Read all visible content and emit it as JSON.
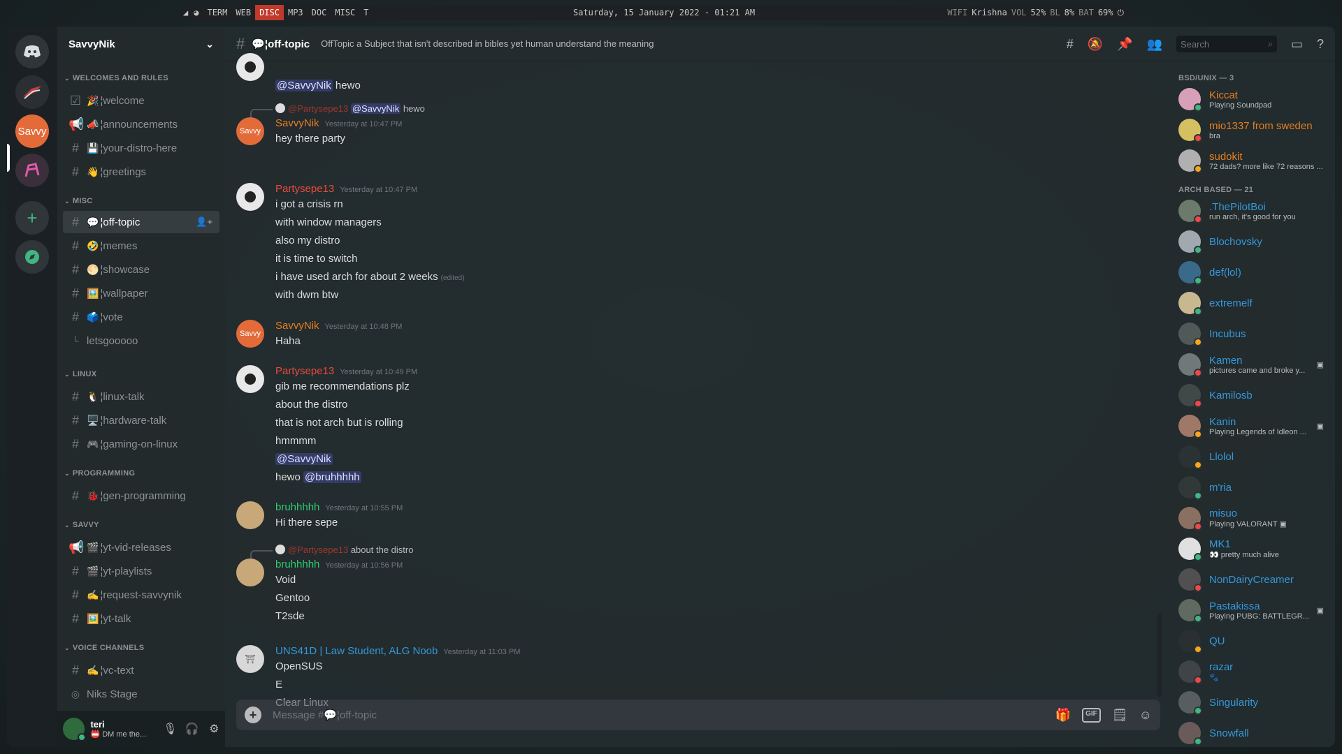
{
  "topbar": {
    "workspaces": [
      {
        "label": "TERM",
        "active": false
      },
      {
        "label": "WEB",
        "active": false
      },
      {
        "label": "DISC",
        "active": true
      },
      {
        "label": "MP3",
        "active": false
      },
      {
        "label": "DOC",
        "active": false
      },
      {
        "label": "MISC",
        "active": false
      },
      {
        "label": "T",
        "active": false
      }
    ],
    "datetime": "Saturday, 15 January 2022 - 01:21 AM",
    "wifi_label": "WIFI",
    "wifi_value": "Krishna",
    "vol_label": "VOL",
    "vol_value": "52%",
    "bl_label": "BL",
    "bl_value": "8%",
    "bat_label": "BAT",
    "bat_value": "69%"
  },
  "rail": {
    "servers": [
      {
        "name": "discord-home-icon"
      },
      {
        "name": "rog-server-icon"
      },
      {
        "name": "savvy-server",
        "label": "Savvy"
      },
      {
        "name": "pink-server-icon"
      },
      {
        "name": "add-server-icon"
      },
      {
        "name": "explore-icon"
      }
    ]
  },
  "sidebar": {
    "server_name": "SavvyNik",
    "categories": [
      {
        "label": "WELCOMES AND RULES",
        "channels": [
          {
            "emoji": "🎉",
            "name": "welcome"
          },
          {
            "emoji": "📣",
            "name": "announcements"
          },
          {
            "emoji": "💾",
            "name": "your-distro-here"
          },
          {
            "emoji": "👋",
            "name": "greetings"
          }
        ]
      },
      {
        "label": "MISC",
        "channels": [
          {
            "emoji": "💬",
            "name": "off-topic"
          },
          {
            "emoji": "🤣",
            "name": "memes"
          },
          {
            "emoji": "🌕",
            "name": "showcase"
          },
          {
            "emoji": "🖼️",
            "name": "wallpaper"
          },
          {
            "emoji": "🗳️",
            "name": "vote"
          },
          {
            "emoji": "",
            "name": "letsgooooo"
          }
        ]
      },
      {
        "label": "LINUX",
        "channels": [
          {
            "emoji": "🐧",
            "name": "linux-talk"
          },
          {
            "emoji": "🖥️",
            "name": "hardware-talk"
          },
          {
            "emoji": "🎮",
            "name": "gaming-on-linux"
          }
        ]
      },
      {
        "label": "PROGRAMMING",
        "channels": [
          {
            "emoji": "🐞",
            "name": "gen-programming"
          }
        ]
      },
      {
        "label": "SAVVY",
        "channels": [
          {
            "emoji": "🎬",
            "name": "yt-vid-releases"
          },
          {
            "emoji": "🎬",
            "name": "yt-playlists"
          },
          {
            "emoji": "✍️",
            "name": "request-savvynik"
          },
          {
            "emoji": "🖼️",
            "name": "yt-talk"
          }
        ]
      },
      {
        "label": "VOICE CHANNELS",
        "channels": [
          {
            "emoji": "✍️",
            "name": "vc-text"
          },
          {
            "emoji": "",
            "name": "Niks Stage"
          }
        ]
      }
    ],
    "user": {
      "name": "teri",
      "status": "📛 DM me the..."
    }
  },
  "chat": {
    "channel_title": "💬¦off-topic",
    "topic": "OffTopic a Subject that isn't described in bibles yet human understand the meaning",
    "search_placeholder": "Search",
    "composer_placeholder": "Message #💬¦off-topic",
    "gif_label": "GIF",
    "colors": {
      "savvy": "#e67e22",
      "party": "#e74c3c",
      "bruh": "#2ecc71",
      "uns": "#3498db"
    },
    "messages": {
      "m0": {
        "mention": "@SavvyNik",
        "text": "hewo"
      },
      "m1": {
        "reply_name": "@Partysepe13",
        "reply_mention": "@SavvyNik",
        "reply_text": "hewo",
        "author": "SavvyNik",
        "time": "Yesterday at 10:47 PM",
        "avatar": "Savvy",
        "lines": [
          "hey there party"
        ]
      },
      "m2": {
        "author": "Partysepe13",
        "time": "Yesterday at 10:47 PM",
        "lines": [
          "i got a crisis rn",
          "with window managers",
          "also my distro",
          "it is time to switch",
          "i have used arch for about 2 weeks",
          "with dwm btw"
        ],
        "edited": "(edited)"
      },
      "m3": {
        "author": "SavvyNik",
        "time": "Yesterday at 10:48 PM",
        "avatar": "Savvy",
        "lines": [
          "Haha"
        ]
      },
      "m4": {
        "author": "Partysepe13",
        "time": "Yesterday at 10:49 PM",
        "lines": [
          "gib me recommendations plz",
          "about the distro",
          "that is not arch but is rolling",
          "hmmmm"
        ],
        "mention1": "@SavvyNik",
        "hewo": "hewo",
        "mention2": "@bruhhhhh"
      },
      "m5": {
        "author": "bruhhhhh",
        "time": "Yesterday at 10:55 PM",
        "lines": [
          "Hi there sepe"
        ]
      },
      "m6": {
        "reply_name": "@Partysepe13",
        "reply_text": "about the distro",
        "author": "bruhhhhh",
        "time": "Yesterday at 10:56 PM",
        "lines": [
          "Void",
          "Gentoo",
          "T2sde"
        ]
      },
      "m7": {
        "author": "UNS41D | Law Student, ALG Noob",
        "time": "Yesterday at 11:03 PM",
        "lines": [
          "OpenSUS",
          "E",
          "Clear Linux"
        ]
      }
    }
  },
  "members": {
    "groups": [
      {
        "label": "BSD/UNIX — 3",
        "items": [
          {
            "name": "Kiccat",
            "status": "Playing Soundpad",
            "color": "#e67e22",
            "dot": "#43b581",
            "av": "#d8a0b8"
          },
          {
            "name": "mio1337 from sweden",
            "status": "bra",
            "color": "#e67e22",
            "dot": "#f04747",
            "av": "#d4c060"
          },
          {
            "name": "sudokit",
            "status": "72 dads? more like 72 reasons ...",
            "color": "#e67e22",
            "dot": "#faa61a",
            "av": "#b0b0b0"
          }
        ]
      },
      {
        "label": "ARCH BASED — 21",
        "items": [
          {
            "name": ".ThePilotBoi",
            "status": "run arch, it's good for you",
            "color": "#3498db",
            "dot": "#f04747",
            "av": "#6b7a6b"
          },
          {
            "name": "Blochovsky",
            "status": "",
            "color": "#3498db",
            "dot": "#43b581",
            "av": "#a0a8b0"
          },
          {
            "name": "def(lol)",
            "status": "",
            "color": "#3498db",
            "dot": "#43b581",
            "av": "#3a6a8a"
          },
          {
            "name": "extremelf",
            "status": "",
            "color": "#3498db",
            "dot": "#43b581",
            "av": "#c8b890"
          },
          {
            "name": "Incubus",
            "status": "",
            "color": "#3498db",
            "dot": "#faa61a",
            "av": "#505858"
          },
          {
            "name": "Kamen",
            "status": "pictures came and broke y...",
            "color": "#3498db",
            "dot": "#f04747",
            "av": "#70787a",
            "act": "▣"
          },
          {
            "name": "Kamilosb",
            "status": "",
            "color": "#3498db",
            "dot": "#f04747",
            "av": "#404848"
          },
          {
            "name": "Kanin",
            "status": "Playing Legends of Idleon ...",
            "color": "#3498db",
            "dot": "#faa61a",
            "av": "#a07868",
            "act": "▣"
          },
          {
            "name": "Llolol",
            "status": "",
            "color": "#3498db",
            "dot": "#faa61a",
            "av": "#2a3234"
          },
          {
            "name": "m'ria",
            "status": "",
            "color": "#3498db",
            "dot": "#43b581",
            "av": "#303838"
          },
          {
            "name": "misuo",
            "status": "Playing VALORANT ▣",
            "color": "#3498db",
            "dot": "#f04747",
            "av": "#8a7060"
          },
          {
            "name": "MK1",
            "status": "👀 pretty much alive",
            "color": "#3498db",
            "dot": "#43b581",
            "av": "#e0e0e0"
          },
          {
            "name": "NonDairyCreamer",
            "status": "",
            "color": "#3498db",
            "dot": "#f04747",
            "av": "#505050"
          },
          {
            "name": "Pastakissa",
            "status": "Playing PUBG: BATTLEGR...",
            "color": "#3498db",
            "dot": "#43b581",
            "av": "#606a60",
            "act": "▣"
          },
          {
            "name": "QU",
            "status": "",
            "color": "#3498db",
            "dot": "#faa61a",
            "av": "#2a3032"
          },
          {
            "name": "razar",
            "status": "🐾",
            "color": "#3498db",
            "dot": "#f04747",
            "av": "#404446"
          },
          {
            "name": "Singularity",
            "status": "",
            "color": "#3498db",
            "dot": "#43b581",
            "av": "#585e60"
          },
          {
            "name": "Snowfall",
            "status": "",
            "color": "#3498db",
            "dot": "#43b581",
            "av": "#6a5a5a"
          }
        ]
      }
    ]
  }
}
